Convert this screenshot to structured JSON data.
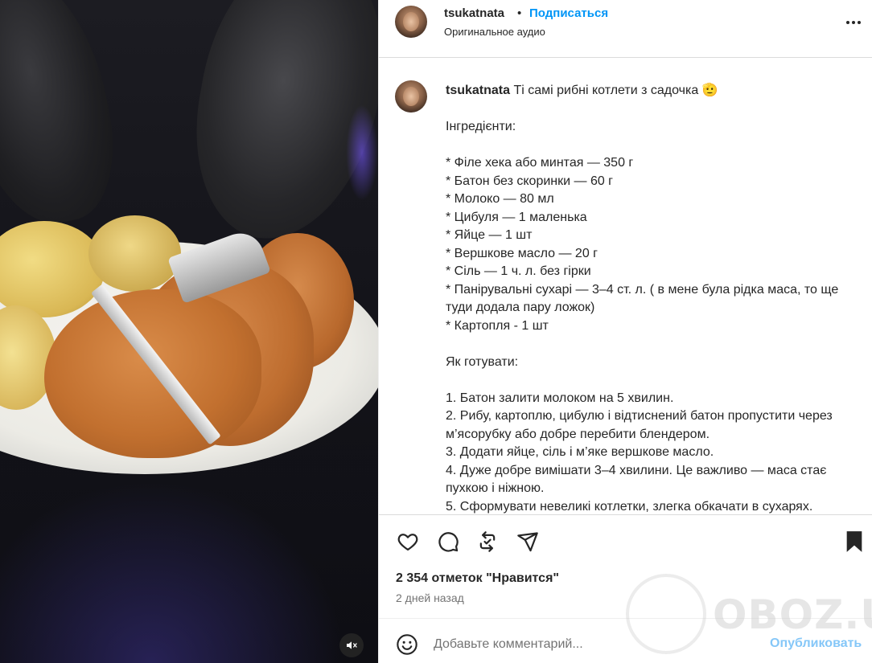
{
  "post": {
    "username": "tsukatnata",
    "dot": "•",
    "follow_label": "Подписаться",
    "audio_label": "Оригинальное аудио"
  },
  "caption": {
    "username": "tsukatnata",
    "title": "Ті самі рибні котлети з садочка 🫡",
    "lines": [
      "Інгредієнти:",
      "",
      "* Філе хека або минтая — 350 г",
      "* Батон без скоринки — 60 г",
      "* Молоко — 80 мл",
      "* Цибуля — 1 маленька",
      "* Яйце — 1 шт",
      "* Вершкове масло — 20 г",
      "* Сіль — 1 ч. л. без гірки",
      "* Панірувальні сухарі — 3–4 ст. л. ( в мене була рідка маса, то ще туди додала пару ложок)",
      "* Картопля - 1 шт",
      "",
      "Як готувати:",
      "",
      "1. Батон залити молоком на 5 хвилин.",
      "2. Рибу, картоплю, цибулю і відтиснений батон пропустити через м’ясорубку або добре перебити блендером.",
      "3. Додати яйце, сіль і м’яке вершкове масло.",
      "4. Дуже добре вимішати 3–4 хвилини. Це важливо — маса стає пухкою і ніжною.",
      "5. Сформувати невеликі котлетки, злегка обкачати в сухарях."
    ]
  },
  "stats": {
    "likes": "2 354 отметок \"Нравится\"",
    "date": "2 дней назад"
  },
  "comment": {
    "placeholder": "Добавьте комментарий...",
    "publish_label": "Опубликовать"
  },
  "watermark": {
    "text": "OBOZ.UA"
  },
  "icons": {
    "like": "heart-icon",
    "comment": "comment-icon",
    "repost": "repost-icon",
    "share": "share-icon",
    "save": "bookmark-icon",
    "emoji": "emoji-icon",
    "mute": "muted-speaker-icon",
    "more": "more-icon"
  },
  "colors": {
    "accent": "#0095f6",
    "publish_disabled": "#85c7f8",
    "text": "#262626",
    "secondary": "#737373"
  }
}
